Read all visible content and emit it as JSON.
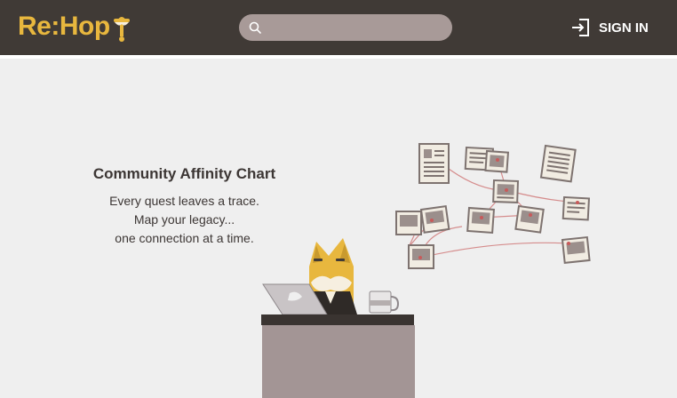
{
  "header": {
    "logo_text": "Re:Hop",
    "search": {
      "placeholder": "",
      "value": ""
    },
    "signin_label": "SIGN IN"
  },
  "hero": {
    "title": "Community Affinity Chart",
    "lines": [
      "Every quest leaves a trace.",
      "Map your legacy...",
      "one connection at a time."
    ]
  },
  "colors": {
    "header_bg": "#403a36",
    "brand_yellow": "#e8b73e",
    "search_bg": "#a89a98",
    "page_bg": "#efefef",
    "desk": "#a39595",
    "thread": "#d58c8c"
  }
}
